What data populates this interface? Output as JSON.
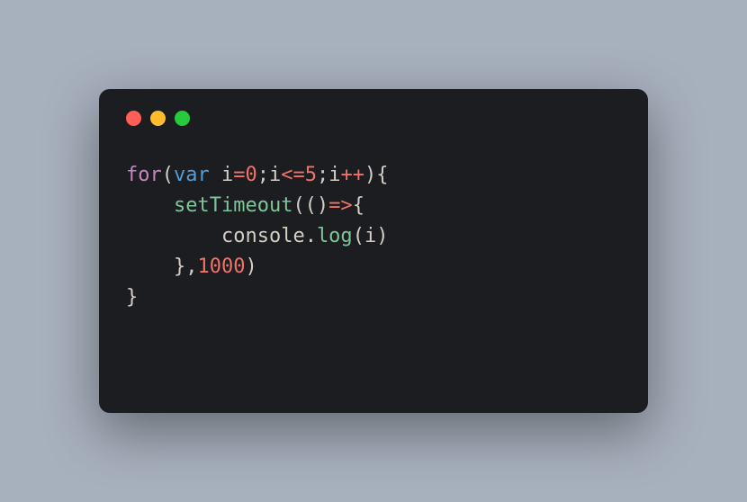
{
  "window": {
    "controls": [
      "close",
      "minimize",
      "maximize"
    ]
  },
  "code": {
    "tokens": [
      {
        "cls": "kw",
        "t": "for"
      },
      {
        "cls": "punct",
        "t": "("
      },
      {
        "cls": "var",
        "t": "var"
      },
      {
        "cls": "punct",
        "t": " "
      },
      {
        "cls": "ident",
        "t": "i"
      },
      {
        "cls": "op",
        "t": "="
      },
      {
        "cls": "num",
        "t": "0"
      },
      {
        "cls": "punct",
        "t": ";"
      },
      {
        "cls": "ident",
        "t": "i"
      },
      {
        "cls": "op",
        "t": "<="
      },
      {
        "cls": "num",
        "t": "5"
      },
      {
        "cls": "punct",
        "t": ";"
      },
      {
        "cls": "ident",
        "t": "i"
      },
      {
        "cls": "op",
        "t": "++"
      },
      {
        "cls": "punct",
        "t": "){"
      },
      {
        "cls": "nl",
        "t": "\n"
      },
      {
        "cls": "punct",
        "t": "    "
      },
      {
        "cls": "fn",
        "t": "setTimeout"
      },
      {
        "cls": "punct",
        "t": "(()"
      },
      {
        "cls": "op",
        "t": "=>"
      },
      {
        "cls": "punct",
        "t": "{"
      },
      {
        "cls": "nl",
        "t": "\n"
      },
      {
        "cls": "punct",
        "t": "        "
      },
      {
        "cls": "obj",
        "t": "console"
      },
      {
        "cls": "punct",
        "t": "."
      },
      {
        "cls": "method",
        "t": "log"
      },
      {
        "cls": "punct",
        "t": "("
      },
      {
        "cls": "ident",
        "t": "i"
      },
      {
        "cls": "punct",
        "t": ")"
      },
      {
        "cls": "nl",
        "t": "\n"
      },
      {
        "cls": "punct",
        "t": "    },"
      },
      {
        "cls": "num",
        "t": "1000"
      },
      {
        "cls": "punct",
        "t": ")"
      },
      {
        "cls": "nl",
        "t": "\n"
      },
      {
        "cls": "punct",
        "t": "}"
      }
    ]
  }
}
